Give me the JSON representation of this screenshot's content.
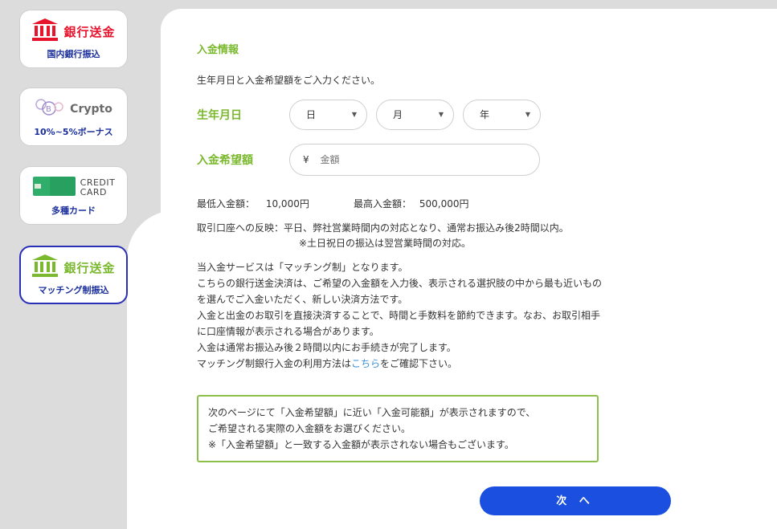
{
  "sidebar": {
    "tabs": [
      {
        "title": "銀行送金",
        "sub": "国内銀行振込"
      },
      {
        "title": "Crypto",
        "sub": "10%~5%ボーナス"
      },
      {
        "title_line1": "CREDIT",
        "title_line2": "CARD",
        "sub": "多種カード",
        "card_text": "CREDIT CARD"
      },
      {
        "title": "銀行送金",
        "sub": "マッチング制振込"
      }
    ]
  },
  "form": {
    "section_title": "入金情報",
    "intro": "生年月日と入金希望額をご入力ください。",
    "dob_label": "生年月日",
    "day": "日",
    "month": "月",
    "year": "年",
    "amount_label": "入金希望額",
    "currency": "¥",
    "amount_placeholder": "金額"
  },
  "info": {
    "min_label": "最低入金額：",
    "min_value": "10,000円",
    "max_label": "最高入金額：",
    "max_value": "500,000円",
    "reflect_1": "取引口座への反映：平日、弊社営業時間内の対応となり、通常お振込み後2時間以内。",
    "reflect_2": "※土日祝日の振込は翌営業時間の対応。",
    "desc_1": "当入金サービスは「マッチング制」となります。",
    "desc_2": "こちらの銀行送金決済は、ご希望の入金額を入力後、表示される選択肢の中から最も近いもの",
    "desc_3": "を選んでご入金いただく、新しい決済方法です。",
    "desc_4": "入金と出金のお取引を直接決済することで、時間と手数料を節約できます。なお、お取引相手",
    "desc_5": "に口座情報が表示される場合があります。",
    "desc_6": "入金は通常お振込み後２時間以内にお手続きが完了します。",
    "desc_7_pre": "マッチング制銀行入金の利用方法は",
    "desc_7_link": "こちら",
    "desc_7_post": "をご確認下さい。"
  },
  "notice": {
    "line1": "次のページにて「入金希望額」に近い「入金可能額」が表示されますので、",
    "line2": "ご希望される実際の入金額をお選びください。",
    "line3": "※「入金希望額」と一致する入金額が表示されない場合もございます。"
  },
  "next_button": "次  へ",
  "colors": {
    "accent_green": "#7ab82d",
    "button_blue": "#1a4fe0",
    "bank_red": "#e6142d",
    "active_border": "#2a2fb8"
  }
}
